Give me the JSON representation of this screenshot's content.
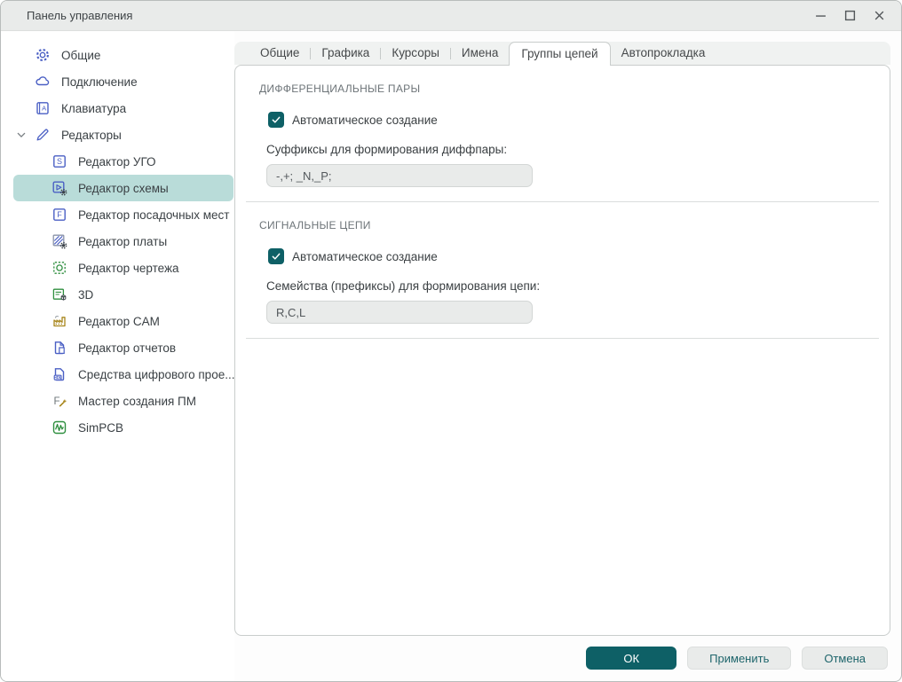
{
  "window": {
    "title": "Панель управления",
    "controls": [
      "minimize",
      "maximize",
      "close"
    ]
  },
  "sidebar": {
    "items": [
      {
        "label": "Общие",
        "icon": "gear-icon",
        "level": 0
      },
      {
        "label": "Подключение",
        "icon": "cloud-icon",
        "level": 0
      },
      {
        "label": "Клавиатура",
        "icon": "keyboard-icon",
        "level": 0
      },
      {
        "label": "Редакторы",
        "icon": "pencil-icon",
        "level": 0,
        "expanded": true
      },
      {
        "label": "Редактор УГО",
        "icon": "symbol-editor-icon",
        "level": 1
      },
      {
        "label": "Редактор схемы",
        "icon": "schematic-editor-icon",
        "level": 1,
        "selected": true
      },
      {
        "label": "Редактор посадочных мест",
        "icon": "footprint-editor-icon",
        "level": 1
      },
      {
        "label": "Редактор платы",
        "icon": "board-editor-icon",
        "level": 1
      },
      {
        "label": "Редактор чертежа",
        "icon": "drawing-editor-icon",
        "level": 1
      },
      {
        "label": "3D",
        "icon": "3d-editor-icon",
        "level": 1
      },
      {
        "label": "Редактор CAM",
        "icon": "cam-editor-icon",
        "level": 1
      },
      {
        "label": "Редактор отчетов",
        "icon": "report-editor-icon",
        "level": 1
      },
      {
        "label": "Средства цифрового прое...",
        "icon": "hdl-tools-icon",
        "level": 1
      },
      {
        "label": "Мастер создания ПМ",
        "icon": "wizard-icon",
        "level": 1
      },
      {
        "label": "SimPCB",
        "icon": "simpcb-icon",
        "level": 1
      }
    ]
  },
  "tabs": {
    "items": [
      {
        "label": "Общие",
        "active": false
      },
      {
        "label": "Графика",
        "active": false
      },
      {
        "label": "Курсоры",
        "active": false
      },
      {
        "label": "Имена",
        "active": false
      },
      {
        "label": "Группы цепей",
        "active": true
      },
      {
        "label": "Автопрокладка",
        "active": false
      }
    ]
  },
  "panel": {
    "sections": [
      {
        "header": "ДИФФЕРЕНЦИАЛЬНЫЕ ПАРЫ",
        "checkbox": {
          "label": "Автоматическое создание",
          "checked": true
        },
        "field": {
          "label": "Суффиксы для формирования диффпары:",
          "value": "-,+; _N,_P;"
        }
      },
      {
        "header": "СИГНАЛЬНЫЕ ЦЕПИ",
        "checkbox": {
          "label": "Автоматическое создание",
          "checked": true
        },
        "field": {
          "label": "Семейства (префиксы) для формирования цепи:",
          "value": "R,C,L"
        }
      }
    ]
  },
  "footer": {
    "ok": "ОК",
    "apply": "Применить",
    "cancel": "Отмена"
  },
  "colors": {
    "accent_teal": "#0e6066",
    "selection_teal": "#b9dcd9",
    "icon_blue": "#4a5fc4",
    "icon_green": "#2f8f3f",
    "icon_gold": "#a8861c",
    "titlebar_bg": "#e9ebea",
    "panel_border": "#c9cdcc",
    "input_bg": "#e9ebea"
  }
}
